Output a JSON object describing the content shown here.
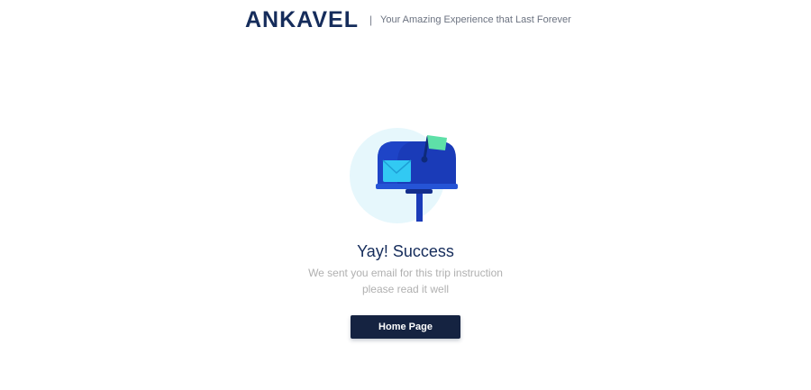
{
  "header": {
    "brand": "ANKAVEL",
    "separator": "|",
    "tagline": "Your Amazing Experience that Last Forever"
  },
  "illustration": {
    "icon": "mailbox-icon",
    "colors": {
      "circle": "#e6f7fc",
      "mailbox": "#1a3bb8",
      "flag": "#5ee0a8",
      "envelope": "#32c9f3",
      "post": "#1a3bb8"
    }
  },
  "message": {
    "title": "Yay! Success",
    "line1": "We sent you email for this trip instruction",
    "line2": "please read it well"
  },
  "actions": {
    "home_label": "Home Page"
  },
  "colors": {
    "brand": "#152c5b",
    "button": "#152341"
  }
}
